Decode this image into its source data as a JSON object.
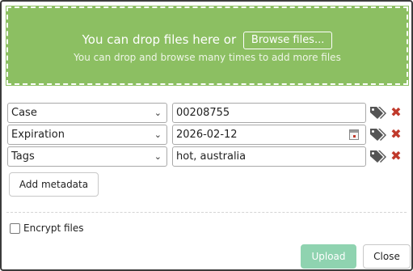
{
  "dropzone": {
    "line1": "You can drop files here or",
    "browse_label": "Browse files...",
    "line2": "You can drop and browse many times to add more files"
  },
  "metadata_rows": [
    {
      "field": "Case",
      "value": "00208755"
    },
    {
      "field": "Expiration",
      "value": "2026-02-12"
    },
    {
      "field": "Tags",
      "value": "hot, australia"
    }
  ],
  "add_metadata_label": "Add metadata",
  "encrypt_label": "Encrypt files",
  "encrypt_checked": false,
  "footer": {
    "upload_label": "Upload",
    "close_label": "Close"
  },
  "colors": {
    "dropzone_bg": "#8cbf62",
    "delete_red": "#c0392b",
    "upload_disabled": "#8fd3b0",
    "tag_icon": "#555555"
  }
}
